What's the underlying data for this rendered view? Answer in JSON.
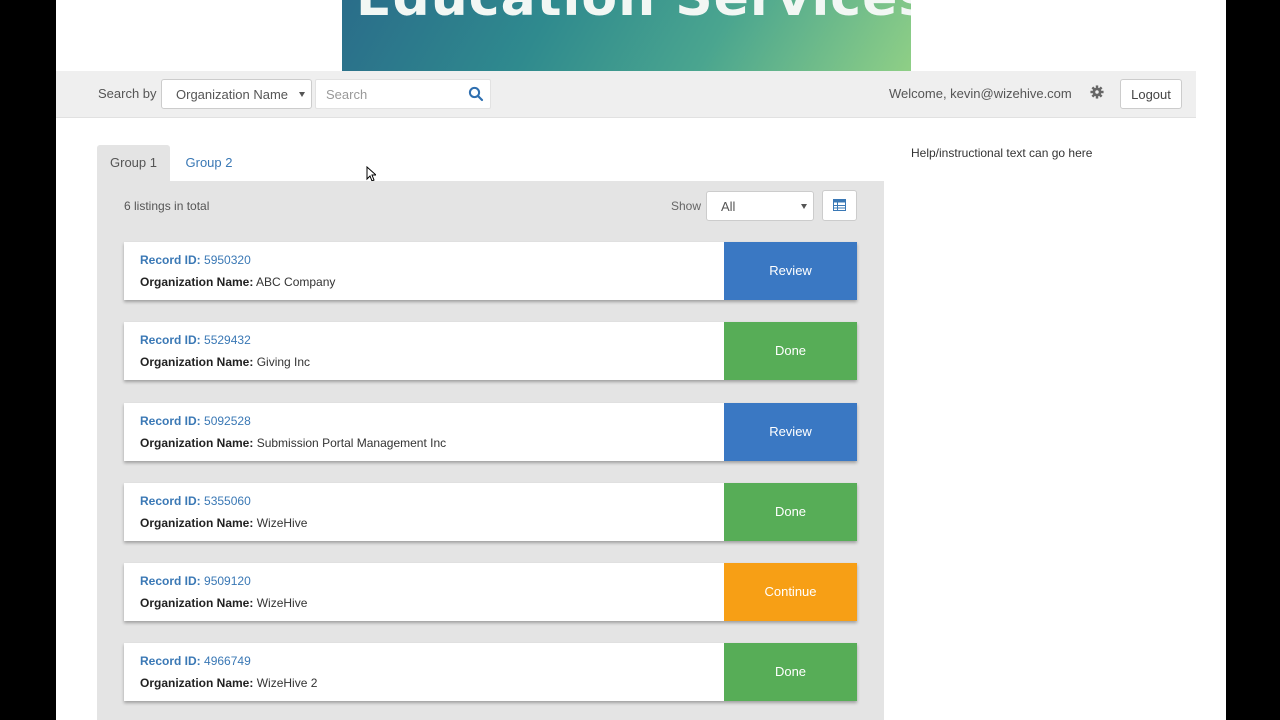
{
  "banner": {
    "title": "Education Services"
  },
  "topbar": {
    "search_by_label": "Search by",
    "search_field": "Organization Name",
    "search_placeholder": "Search",
    "welcome": "Welcome, kevin@wizehive.com",
    "logout_label": "Logout"
  },
  "tabs": [
    {
      "label": "Group 1",
      "active": true
    },
    {
      "label": "Group 2",
      "active": false
    }
  ],
  "listing": {
    "count_text": "6 listings in total",
    "show_label": "Show",
    "show_value": "All"
  },
  "record_labels": {
    "id": "Record ID:",
    "org": "Organization Name:"
  },
  "records": [
    {
      "id": "5950320",
      "org": "ABC Company",
      "action": "Review",
      "color": "#3a78c3"
    },
    {
      "id": "5529432",
      "org": "Giving Inc",
      "action": "Done",
      "color": "#57ad57"
    },
    {
      "id": "5092528",
      "org": "Submission Portal Management Inc",
      "action": "Review",
      "color": "#3a78c3"
    },
    {
      "id": "5355060",
      "org": "WizeHive",
      "action": "Done",
      "color": "#57ad57"
    },
    {
      "id": "9509120",
      "org": "WizeHive",
      "action": "Continue",
      "color": "#f79f15"
    },
    {
      "id": "4966749",
      "org": "WizeHive 2",
      "action": "Done",
      "color": "#57ad57"
    }
  ],
  "help_text": "Help/instructional text can go here",
  "icons": {
    "search": "search-icon",
    "settings": "gear-icon",
    "table_view": "table-view-icon"
  }
}
